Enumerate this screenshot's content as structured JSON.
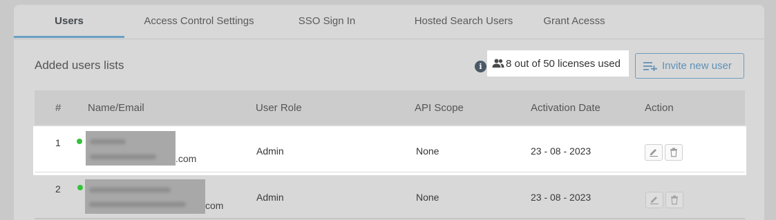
{
  "tabs": [
    {
      "label": "Users",
      "active": true
    },
    {
      "label": "Access Control Settings",
      "active": false
    },
    {
      "label": "SSO Sign In",
      "active": false
    },
    {
      "label": "Hosted Search Users",
      "active": false
    },
    {
      "label": "Grant Acesss",
      "active": false
    }
  ],
  "section": {
    "title": "Added users lists",
    "info_icon": "i",
    "licenses_text": "8 out of 50 licenses used",
    "invite_label": "Invite new user"
  },
  "table": {
    "columns": [
      "#",
      "Name/Email",
      "User Role",
      "API Scope",
      "Activation Date",
      "Action"
    ],
    "rows": [
      {
        "index": "1",
        "email_suffix": ".com",
        "role": "Admin",
        "api_scope": "None",
        "activation_date": "23 - 08 - 2023",
        "status": "active"
      },
      {
        "index": "2",
        "email_suffix": "com",
        "role": "Admin",
        "api_scope": "None",
        "activation_date": "23 - 08 - 2023",
        "status": "active"
      }
    ]
  },
  "colors": {
    "accent": "#6a9fc4",
    "status_active": "#35c23b",
    "info_icon_bg": "#4b5966"
  },
  "icons": {
    "info": "info-icon",
    "users": "users-icon",
    "invite": "add-list-icon",
    "edit": "pencil-icon",
    "delete": "trash-icon"
  }
}
